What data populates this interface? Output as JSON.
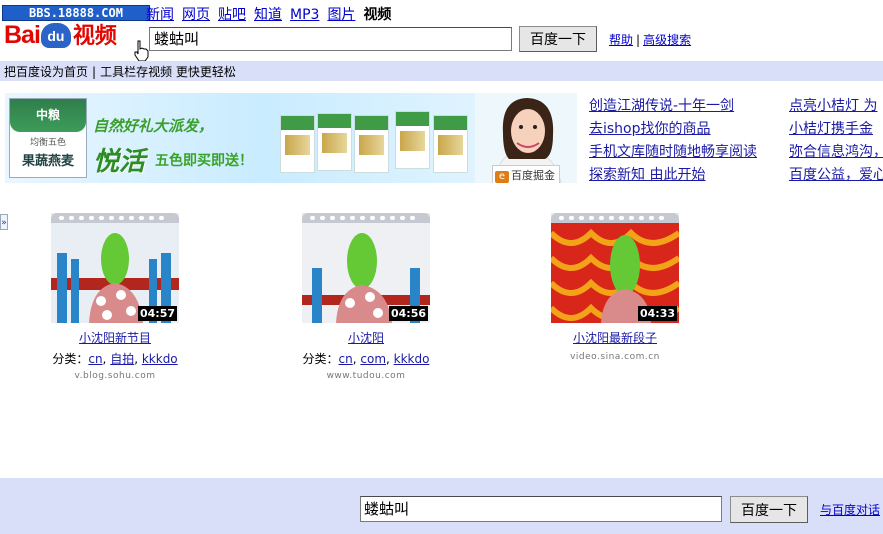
{
  "watermark": "BBS.18888.COM",
  "logo": {
    "bai": "Bai",
    "du": "du",
    "product": "视频"
  },
  "nav": {
    "items": [
      {
        "label": "新闻",
        "current": false
      },
      {
        "label": "网页",
        "current": false
      },
      {
        "label": "贴吧",
        "current": false
      },
      {
        "label": "知道",
        "current": false
      },
      {
        "label": "MP3",
        "current": false
      },
      {
        "label": "图片",
        "current": false
      },
      {
        "label": "视频",
        "current": true
      }
    ]
  },
  "search": {
    "value": "蝼蛄叫",
    "button": "百度一下",
    "help": "帮助",
    "advanced": "高级搜索"
  },
  "band": {
    "set_home": "把百度设为首页",
    "toolbar": "工具栏存视频 更快更轻松"
  },
  "banner": {
    "logo_top": "中粮",
    "logo_sub": "均衡五色",
    "logo_main": "果蔬燕麦",
    "slogan1": "自然好礼大派发，",
    "slogan2": "悦活",
    "slogan3": "五色即买即送！",
    "tag": "百度掘金",
    "tag_icon": "e"
  },
  "ad_links": {
    "col1": [
      "创造江湖传说-十年一剑",
      "去ishop找你的商品",
      "手机文库随时随地畅享阅读",
      "探索新知 由此开始"
    ],
    "col2": [
      "点亮小桔灯 为",
      "小桔灯携手金",
      "弥合信息鸿沟，",
      "百度公益，爱心"
    ]
  },
  "videos": [
    {
      "title": "小沈阳新节目",
      "duration": "04:57",
      "category_label": "分类：",
      "tags": [
        "cn",
        "自拍",
        "kkkdo"
      ],
      "source": "v.blog.sohu.com"
    },
    {
      "title": "小沈阳",
      "duration": "04:56",
      "category_label": "分类：",
      "tags": [
        "cn",
        "com",
        "kkkdo"
      ],
      "source": "www.tudou.com"
    },
    {
      "title": "小沈阳最新段子",
      "duration": "04:33",
      "category_label": "",
      "tags": [],
      "source": "video.sina.com.cn"
    }
  ],
  "footer": {
    "value": "蝼蛄叫",
    "button": "百度一下",
    "link": "与百度对话"
  },
  "colors": {
    "band": "#d9dff8",
    "link": "#1a1aa6",
    "logo_red": "#e10602",
    "logo_blue": "#2b63c6"
  }
}
